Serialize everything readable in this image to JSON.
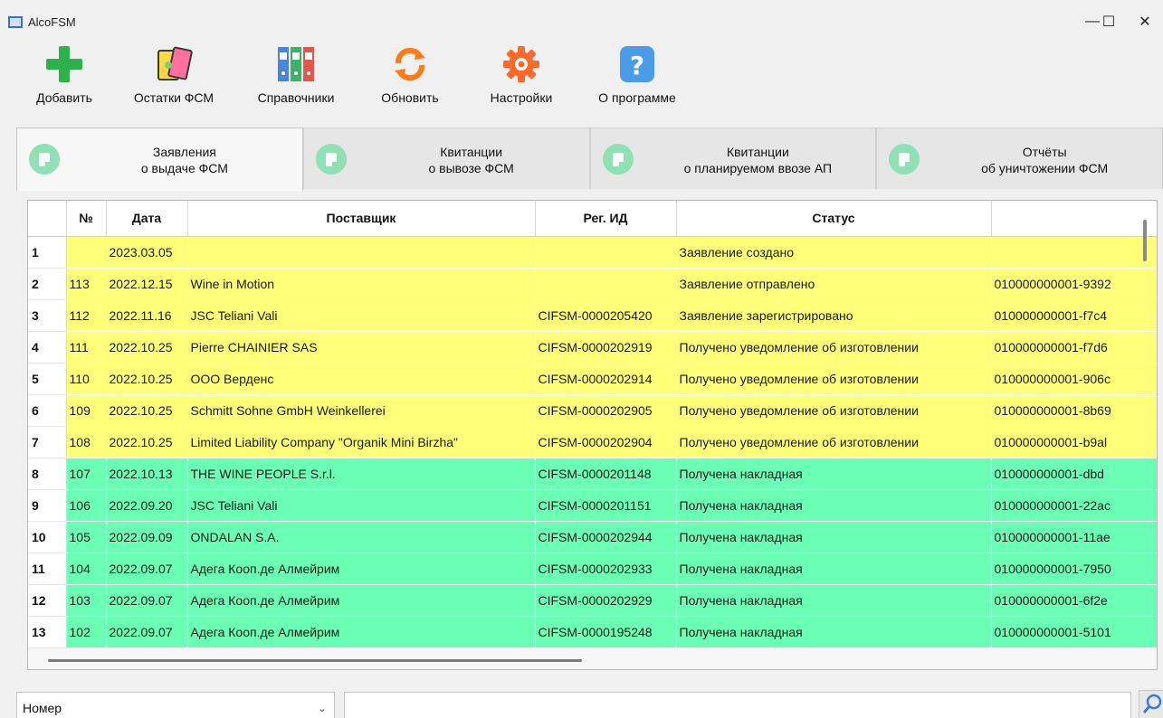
{
  "window": {
    "title": "AlcoFSM",
    "min_glyph": "—",
    "max_glyph": "☐",
    "close_glyph": "✕"
  },
  "toolbar": {
    "add": "Добавить",
    "stock": "Остатки ФСМ",
    "refs": "Справочники",
    "refresh": "Обновить",
    "settings": "Настройки",
    "about": "О программе"
  },
  "tabs": [
    {
      "line1": "Заявления",
      "line2": "о выдаче ФСМ"
    },
    {
      "line1": "Квитанции",
      "line2": "о вывозе ФСМ"
    },
    {
      "line1": "Квитанции",
      "line2": "о планируемом ввозе АП"
    },
    {
      "line1": "Отчёты",
      "line2": "об уничтожении ФСМ"
    }
  ],
  "grid": {
    "headers": [
      "№",
      "Дата",
      "Поставщик",
      "Рег. ИД",
      "Статус",
      ""
    ],
    "rows": [
      {
        "row": "1",
        "num": "",
        "date": "2023.03.05",
        "supplier": "",
        "regid": "",
        "status": "Заявление создано",
        "code": ""
      },
      {
        "row": "2",
        "num": "113",
        "date": "2022.12.15",
        "supplier": "Wine in Motion",
        "regid": "",
        "status": "Заявление отправлено",
        "code": "010000000001-9392"
      },
      {
        "row": "3",
        "num": "112",
        "date": "2022.11.16",
        "supplier": "JSC Teliani Vali",
        "regid": "CIFSM-0000205420",
        "status": "Заявление зарегистрировано",
        "code": "010000000001-f7c4"
      },
      {
        "row": "4",
        "num": "111",
        "date": "2022.10.25",
        "supplier": "Pierre CHAINIER SAS",
        "regid": "CIFSM-0000202919",
        "status": "Получено уведомление об изготовлении",
        "code": "010000000001-f7d6"
      },
      {
        "row": "5",
        "num": "110",
        "date": "2022.10.25",
        "supplier": "ООО Верденс",
        "regid": "CIFSM-0000202914",
        "status": "Получено уведомление об изготовлении",
        "code": "010000000001-906c"
      },
      {
        "row": "6",
        "num": "109",
        "date": "2022.10.25",
        "supplier": "Schmitt Sohne GmbH Weinkellerei",
        "regid": "CIFSM-0000202905",
        "status": "Получено уведомление об изготовлении",
        "code": "010000000001-8b69"
      },
      {
        "row": "7",
        "num": "108",
        "date": "2022.10.25",
        "supplier": "Limited Liability Company \"Organik Mini Birzha\"",
        "regid": "CIFSM-0000202904",
        "status": "Получено уведомление об изготовлении",
        "code": "010000000001-b9al"
      },
      {
        "row": "8",
        "num": "107",
        "date": "2022.10.13",
        "supplier": "THE WINE PEOPLE S.r.l.",
        "regid": "CIFSM-0000201148",
        "status": "Получена накладная",
        "code": "010000000001-dbd"
      },
      {
        "row": "9",
        "num": "106",
        "date": "2022.09.20",
        "supplier": "JSC Teliani Vali",
        "regid": "CIFSM-0000201151",
        "status": "Получена накладная",
        "code": "010000000001-22ac"
      },
      {
        "row": "10",
        "num": "105",
        "date": "2022.09.09",
        "supplier": "ONDALAN S.A.",
        "regid": "CIFSM-0000202944",
        "status": "Получена накладная",
        "code": "010000000001-11ae"
      },
      {
        "row": "11",
        "num": "104",
        "date": "2022.09.07",
        "supplier": "Адега Кооп.де Алмейрим",
        "regid": "CIFSM-0000202933",
        "status": "Получена накладная",
        "code": "010000000001-7950"
      },
      {
        "row": "12",
        "num": "103",
        "date": "2022.09.07",
        "supplier": "Адега Кооп.де Алмейрим",
        "regid": "CIFSM-0000202929",
        "status": "Получена накладная",
        "code": "010000000001-6f2e"
      },
      {
        "row": "13",
        "num": "102",
        "date": "2022.09.07",
        "supplier": "Адега Кооп.де Алмейрим",
        "regid": "CIFSM-0000195248",
        "status": "Получена накладная",
        "code": "010000000001-5101"
      }
    ]
  },
  "search": {
    "field": "Номер",
    "value": ""
  },
  "colors": {
    "yellow_row": "#ffff7a",
    "green_row": "#6affb4",
    "tab_icon": "#8fe0b5"
  }
}
